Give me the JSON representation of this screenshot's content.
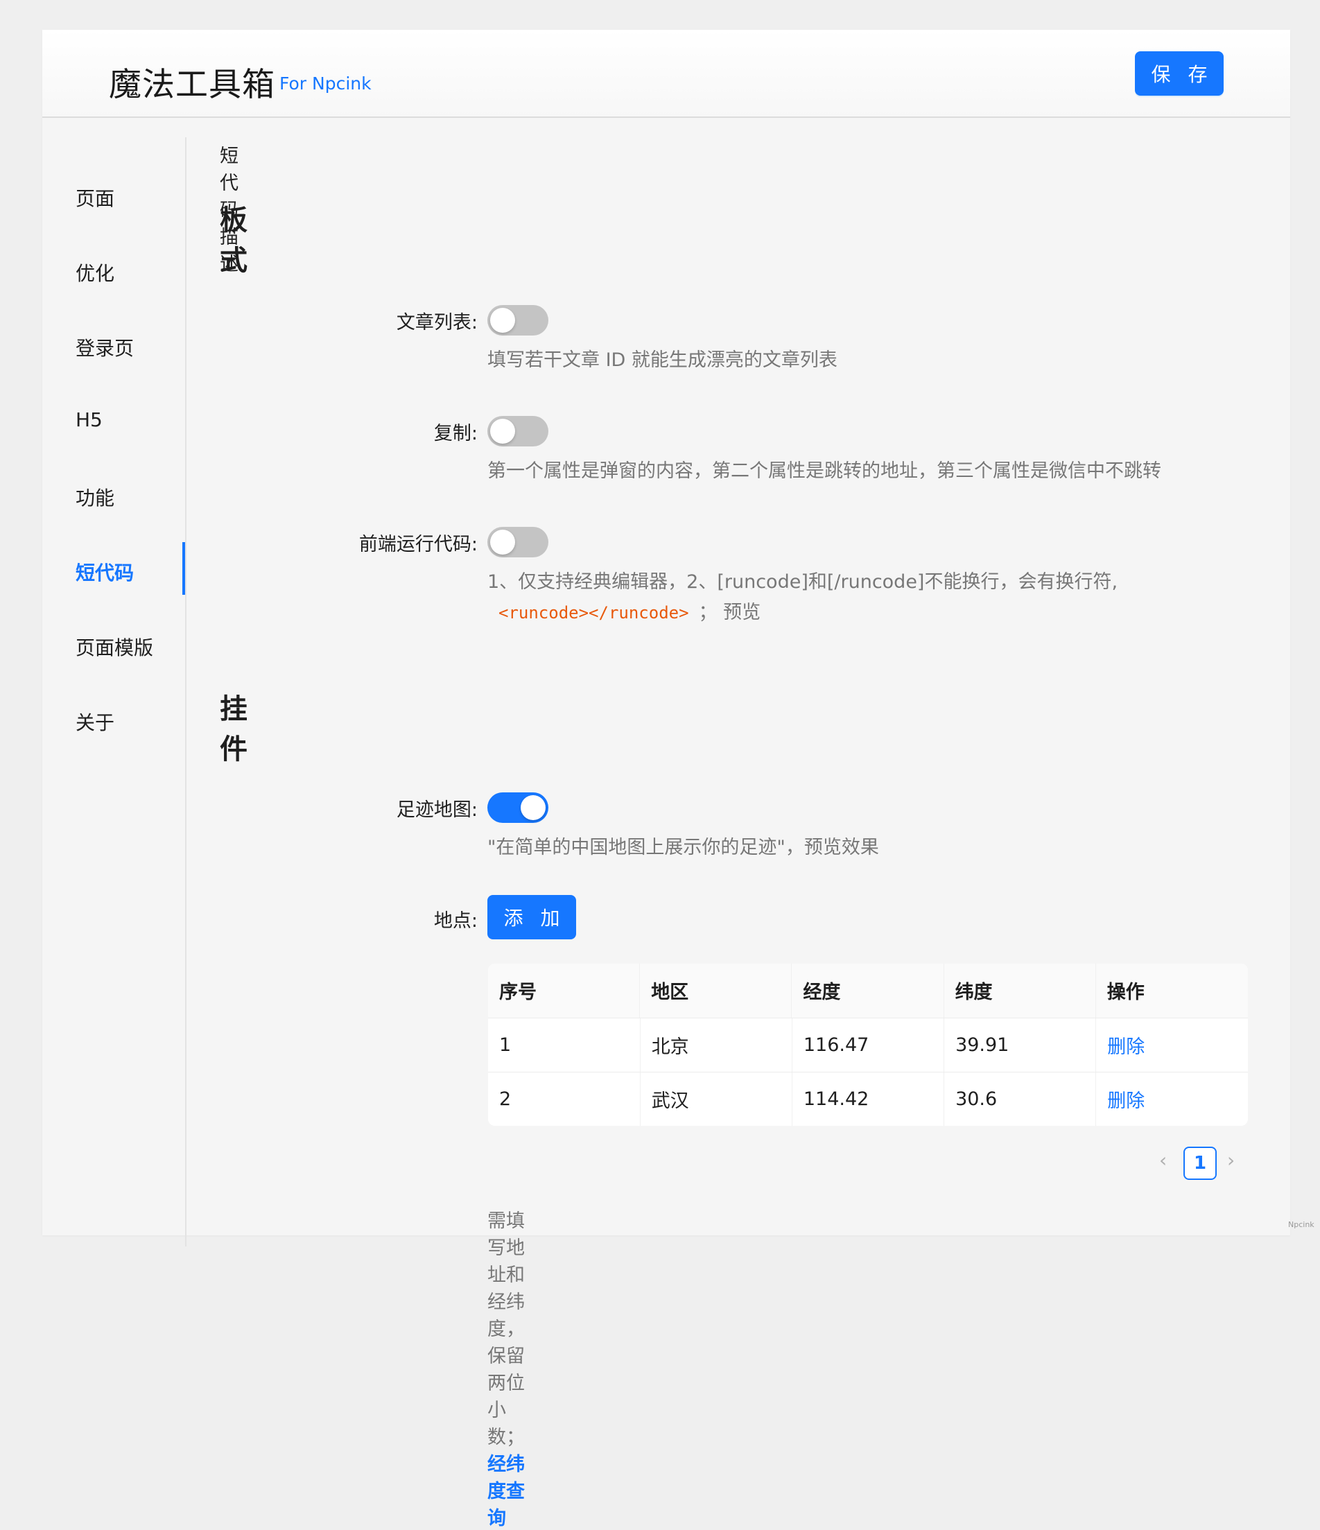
{
  "header": {
    "title": "魔法工具箱",
    "subtitle": "For Npcink",
    "save_label": "保 存"
  },
  "sidebar": {
    "items": [
      {
        "label": "页面"
      },
      {
        "label": "优化"
      },
      {
        "label": "登录页"
      },
      {
        "label": "H5"
      },
      {
        "label": "功能"
      },
      {
        "label": "短代码",
        "active": true
      },
      {
        "label": "页面模版"
      },
      {
        "label": "关于"
      }
    ]
  },
  "main": {
    "description": "短代码描述",
    "section_layout": "板式",
    "section_widgets": "挂件",
    "fields": {
      "article_list": {
        "label": "文章列表:",
        "enabled": false,
        "help": "填写若干文章 ID 就能生成漂亮的文章列表"
      },
      "copy": {
        "label": "复制:",
        "enabled": false,
        "help": "第一个属性是弹窗的内容，第二个属性是跳转的地址，第三个属性是微信中不跳转"
      },
      "runcode": {
        "label": "前端运行代码:",
        "enabled": false,
        "help_line1": "1、仅支持经典编辑器，2、[runcode]和[/runcode]不能换行，会有换行符,",
        "help_code": "<runcode></runcode>",
        "help_sep": "；",
        "help_tail": "预览"
      },
      "footprint_map": {
        "label": "足迹地图:",
        "enabled": true,
        "help": "\"在简单的中国地图上展示你的足迹\"，预览效果"
      },
      "places": {
        "label": "地点:",
        "add_label": "添 加"
      }
    },
    "table": {
      "columns": [
        "序号",
        "地区",
        "经度",
        "纬度",
        "操作"
      ],
      "rows": [
        {
          "index": "1",
          "region": "北京",
          "lng": "116.47",
          "lat": "39.91",
          "action": "删除"
        },
        {
          "index": "2",
          "region": "武汉",
          "lng": "114.42",
          "lat": "30.6",
          "action": "删除"
        }
      ]
    },
    "pagination": {
      "prev": "‹",
      "current": "1",
      "next": "›"
    },
    "footer_note": "需填写地址和经纬度，保留两位小数；",
    "footer_link": "经纬度查询"
  },
  "watermark": "Npcink",
  "colors": {
    "accent": "#1677ff",
    "code": "#e8590c",
    "switch_off": "#c4c4c4"
  }
}
